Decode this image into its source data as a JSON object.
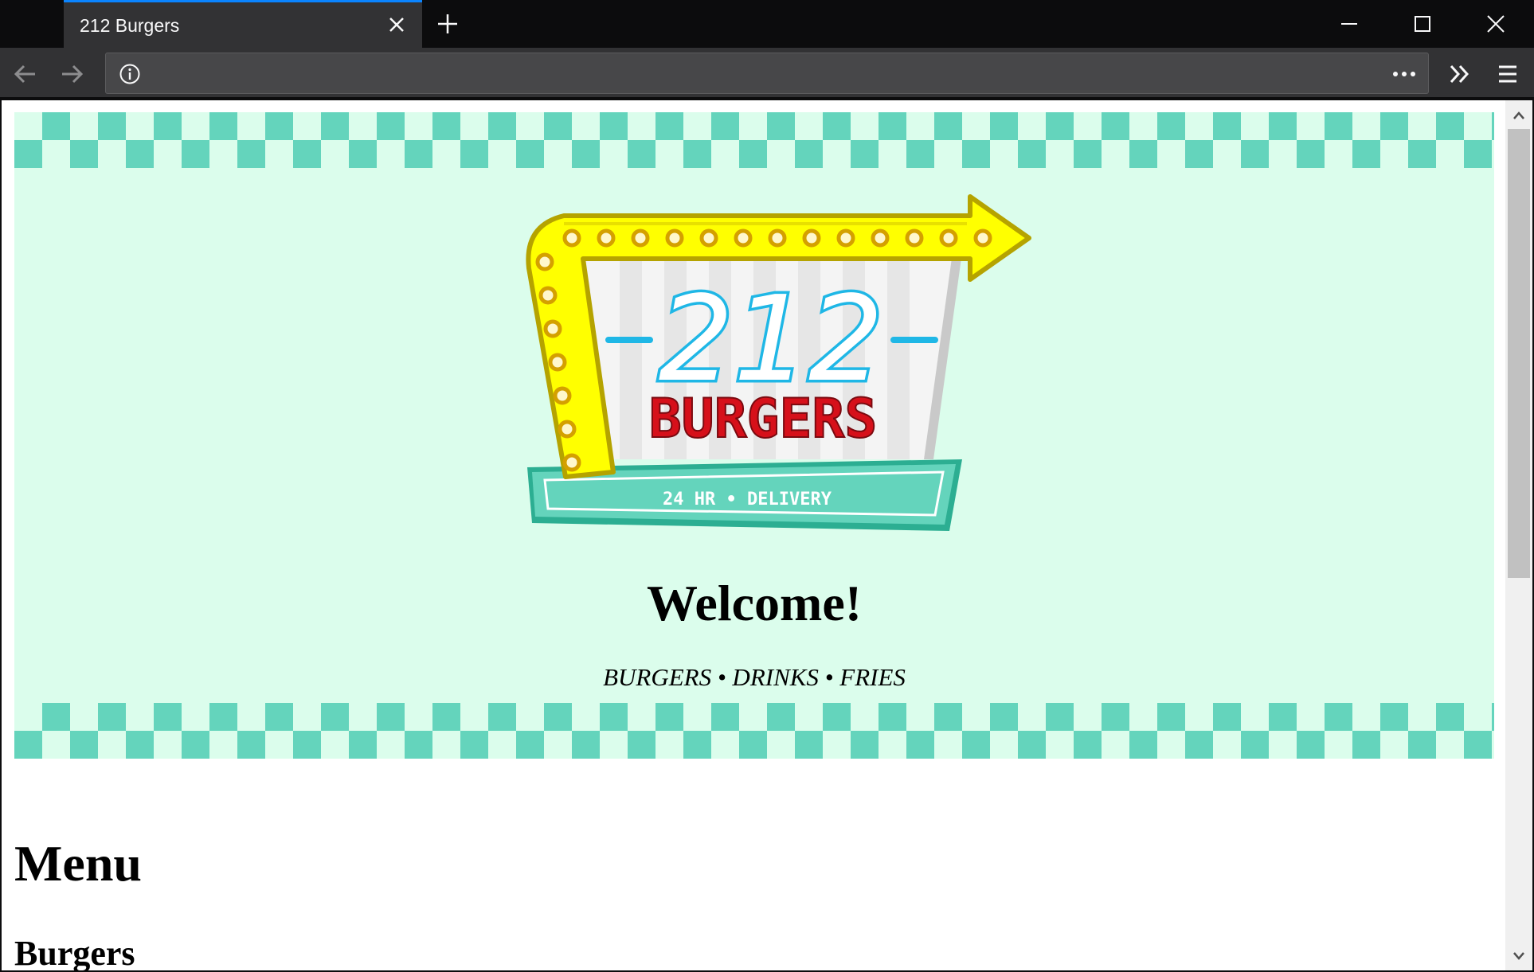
{
  "browser": {
    "tab_title": "212 Burgers",
    "url": ""
  },
  "hero": {
    "logo": {
      "number": "212",
      "name": "BURGERS",
      "banner": "24 HR • DELIVERY"
    },
    "welcome": "Welcome!",
    "tagline": "BURGERS • DRINKS • FRIES"
  },
  "content": {
    "menu_heading": "Menu",
    "section_heading": "Burgers"
  },
  "colors": {
    "hero_bg": "#dbfdec",
    "checker": "#64d4bc",
    "sign_yellow": "#ffff00",
    "neon_blue": "#1fb7e6",
    "burgers_red": "#d6101a",
    "tab_accent": "#0a84ff"
  }
}
